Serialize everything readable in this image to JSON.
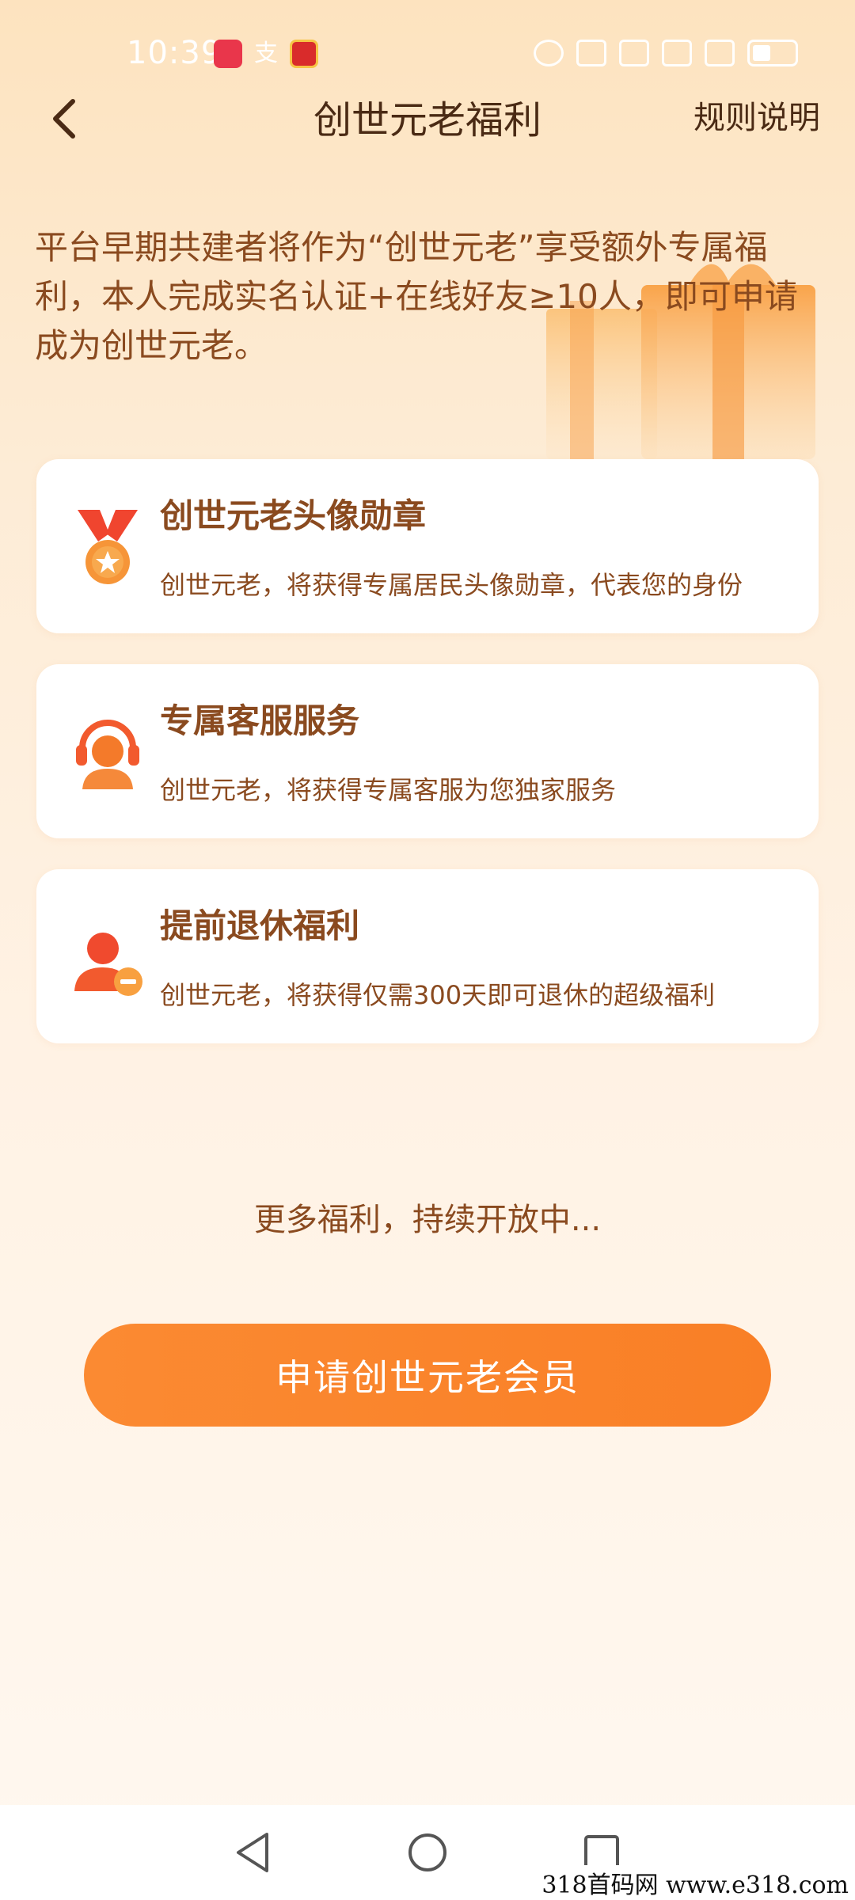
{
  "status_bar": {
    "time": "10:39"
  },
  "header": {
    "title": "创世元老福利",
    "rules_label": "规则说明"
  },
  "intro": {
    "text": "平台早期共建者将作为“创世元老”享受额外专属福利，本人完成实名认证+在线好友≥10人，即可申请成为创世元老。"
  },
  "benefits": [
    {
      "title": "创世元老头像勋章",
      "description": "创世元老，将获得专属居民头像勋章，代表您的身份",
      "icon": "medal-icon"
    },
    {
      "title": "专属客服服务",
      "description": "创世元老，将获得专属客服为您独家服务",
      "icon": "customer-service-icon"
    },
    {
      "title": "提前退休福利",
      "description": "创世元老，将获得仅需300天即可退休的超级福利",
      "icon": "retire-user-icon"
    }
  ],
  "more_text": "更多福利，持续开放中...",
  "apply_button_label": "申请创世元老会员",
  "watermark": "318首码网  www.e318.com",
  "colors": {
    "accent": "#f98229",
    "text_brown": "#8a4a1f",
    "icon_orange": "#f47a2a"
  }
}
